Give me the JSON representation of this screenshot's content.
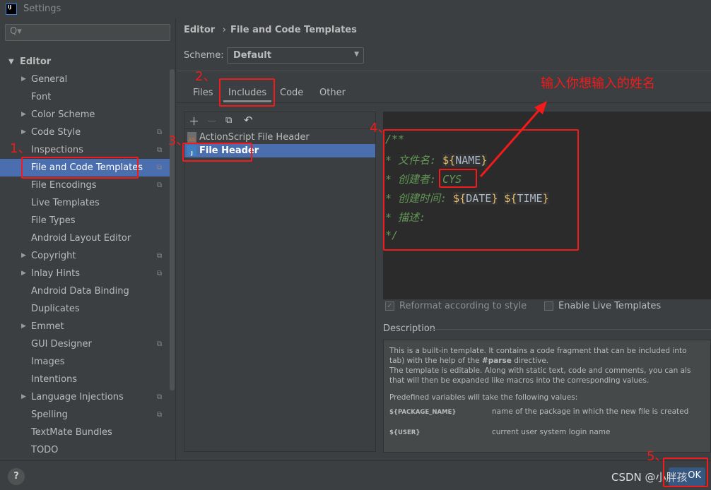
{
  "window": {
    "title": "Settings",
    "logo": "IJ"
  },
  "search": {
    "placeholder": "Q▾"
  },
  "sidebar": {
    "section": "Editor",
    "items": [
      {
        "label": "General",
        "arrow": true,
        "copy": false
      },
      {
        "label": "Font",
        "arrow": false,
        "copy": false
      },
      {
        "label": "Color Scheme",
        "arrow": true,
        "copy": false
      },
      {
        "label": "Code Style",
        "arrow": true,
        "copy": true
      },
      {
        "label": "Inspections",
        "arrow": false,
        "copy": true
      },
      {
        "label": "File and Code Templates",
        "arrow": false,
        "copy": true,
        "selected": true
      },
      {
        "label": "File Encodings",
        "arrow": false,
        "copy": true
      },
      {
        "label": "Live Templates",
        "arrow": false,
        "copy": false
      },
      {
        "label": "File Types",
        "arrow": false,
        "copy": false
      },
      {
        "label": "Android Layout Editor",
        "arrow": false,
        "copy": false
      },
      {
        "label": "Copyright",
        "arrow": true,
        "copy": true
      },
      {
        "label": "Inlay Hints",
        "arrow": true,
        "copy": true
      },
      {
        "label": "Android Data Binding",
        "arrow": false,
        "copy": false
      },
      {
        "label": "Duplicates",
        "arrow": false,
        "copy": false
      },
      {
        "label": "Emmet",
        "arrow": true,
        "copy": false
      },
      {
        "label": "GUI Designer",
        "arrow": false,
        "copy": true
      },
      {
        "label": "Images",
        "arrow": false,
        "copy": false
      },
      {
        "label": "Intentions",
        "arrow": false,
        "copy": false
      },
      {
        "label": "Language Injections",
        "arrow": true,
        "copy": true
      },
      {
        "label": "Spelling",
        "arrow": false,
        "copy": true
      },
      {
        "label": "TextMate Bundles",
        "arrow": false,
        "copy": false
      },
      {
        "label": "TODO",
        "arrow": false,
        "copy": false
      }
    ]
  },
  "breadcrumb": {
    "parent": "Editor",
    "sep": "›",
    "current": "File and Code Templates"
  },
  "scheme": {
    "label": "Scheme:",
    "value": "Default"
  },
  "tabs": [
    "Files",
    "Includes",
    "Code",
    "Other"
  ],
  "active_tab": "Includes",
  "templates": [
    {
      "name": "ActionScript File Header",
      "badge": "AS"
    },
    {
      "name": "File Header",
      "badge": "J",
      "selected": true
    }
  ],
  "code": {
    "l1": "/**",
    "l2": "* 文件名: ",
    "l3": "* 创建者: CYS",
    "l4": "* 创建时间: ",
    "l5": "* 描述:",
    "l6": "*/",
    "v_name": "NAME",
    "v_date": "DATE",
    "v_time": "TIME",
    "dollar": "${",
    "close": "}"
  },
  "options": {
    "reformat": "Reformat according to style",
    "reformat_checked": true,
    "live": "Enable Live Templates",
    "live_checked": false
  },
  "description": {
    "label": "Description",
    "p1a": "This is a built-in template. It contains a code fragment that can be included into",
    "p1b": "tab) with the help of the ",
    "parse": "#parse",
    "p1c": " directive.",
    "p2a": "The template is editable. Along with static text, code and comments, you can als",
    "p2b": "that will then be expanded like macros into the corresponding values.",
    "p3": "Predefined variables will take the following values:",
    "vars": [
      {
        "name": "${PACKAGE_NAME}",
        "desc": "name of the package in which the new file is created"
      },
      {
        "name": "${USER}",
        "desc": "current user system login name"
      }
    ]
  },
  "buttons": {
    "help": "?",
    "ok": "OK"
  },
  "annotations": {
    "n1": "1、",
    "n2": "2、",
    "n3": "3、",
    "n4": "4、",
    "n5": "5、",
    "note": "输入你想输入的姓名",
    "color": "#f21a1a"
  },
  "watermark": "CSDN @小胖孩"
}
